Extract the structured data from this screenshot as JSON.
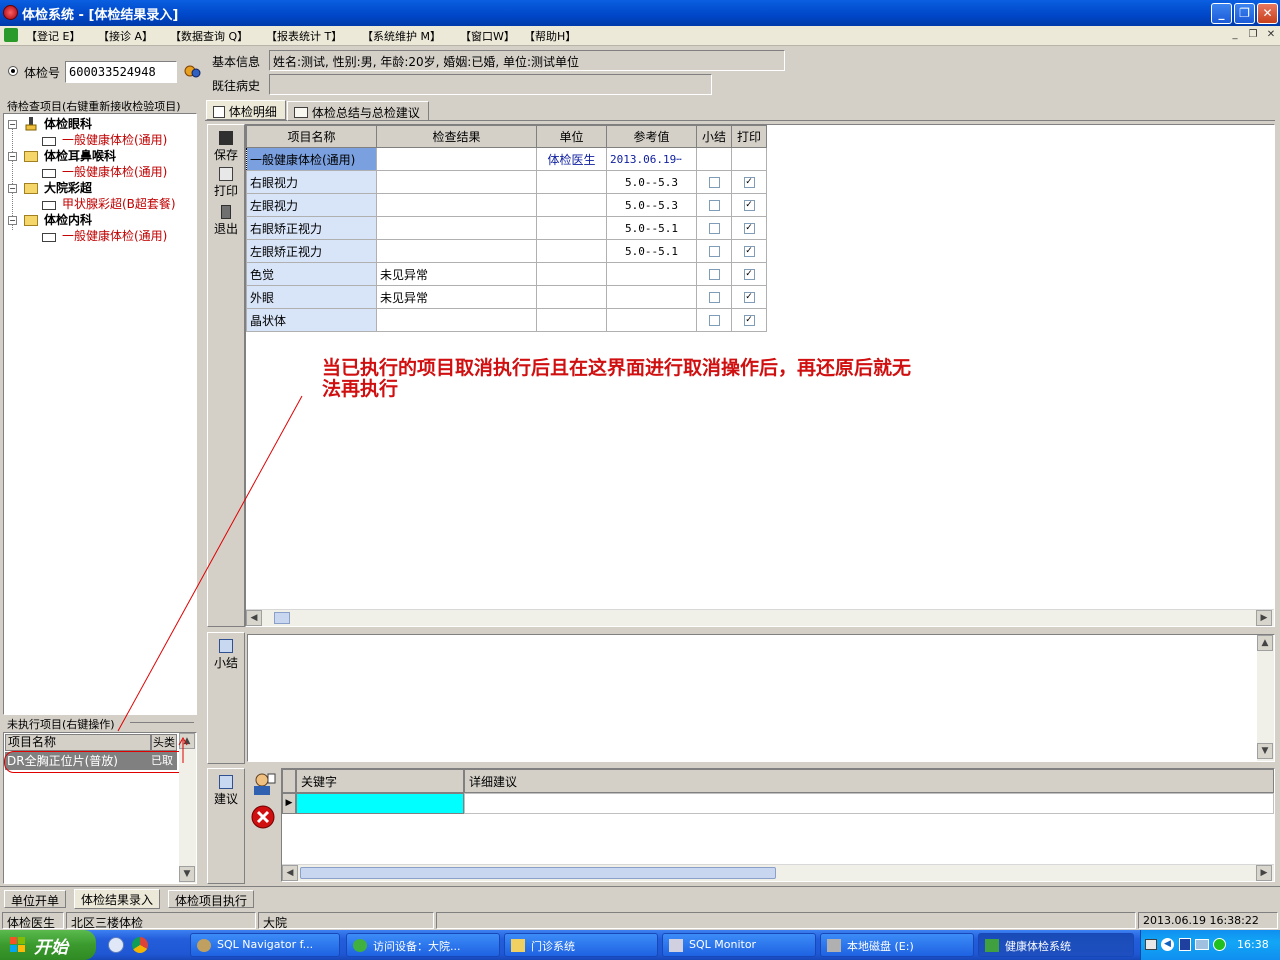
{
  "window": {
    "title": "体检系统 - [体检结果录入]"
  },
  "menu": [
    "【登记 E】",
    "【接诊 A】",
    "【数据查询 Q】",
    "【报表统计 T】",
    "【系统维护 M】",
    "【窗口W】",
    "【帮助H】"
  ],
  "header": {
    "exam_no_label": "体检号",
    "exam_no_value": "600033524948",
    "basic_info_label": "基本信息",
    "basic_info_value": "姓名:测试, 性别:男, 年龄:20岁, 婚姻:已婚, 单位:测试单位",
    "history_label": "既往病史",
    "history_value": ""
  },
  "left_panel": {
    "tree_title": "待检查项目(右键重新接收检验项目)",
    "tree": [
      {
        "dept": "体检眼科",
        "item": "一般健康体检(通用)"
      },
      {
        "dept": "体检耳鼻喉科",
        "item": "一般健康体检(通用)"
      },
      {
        "dept": "大院彩超",
        "item": "甲状腺彩超(B超套餐)"
      },
      {
        "dept": "体检内科",
        "item": "一般健康体检(通用)"
      }
    ],
    "pending_title": "未执行项目(右键操作)",
    "pending_headers": [
      "项目名称",
      "头类"
    ],
    "pending_rows": [
      {
        "name": "DR全胸正位片(普放)",
        "status": "已取"
      }
    ]
  },
  "tabs": [
    "体检明细",
    "体检总结与总检建议"
  ],
  "side_buttons": {
    "save": "保存",
    "print": "打印",
    "exit": "退出"
  },
  "grid": {
    "headers": [
      "项目名称",
      "检查结果",
      "单位",
      "参考值",
      "小结",
      "打印"
    ],
    "rows": [
      {
        "name": "一般健康体检(通用)",
        "result": "",
        "unit": "体检医生",
        "ref": "2013.06.19",
        "summary": null,
        "print": null
      },
      {
        "name": "右眼视力",
        "result": "",
        "unit": "",
        "ref": "5.0--5.3",
        "summary": false,
        "print": true
      },
      {
        "name": "左眼视力",
        "result": "",
        "unit": "",
        "ref": "5.0--5.3",
        "summary": false,
        "print": true
      },
      {
        "name": "右眼矫正视力",
        "result": "",
        "unit": "",
        "ref": "5.0--5.1",
        "summary": false,
        "print": true
      },
      {
        "name": "左眼矫正视力",
        "result": "",
        "unit": "",
        "ref": "5.0--5.1",
        "summary": false,
        "print": true
      },
      {
        "name": "色觉",
        "result": "未见异常",
        "unit": "",
        "ref": "",
        "summary": false,
        "print": true
      },
      {
        "name": "外眼",
        "result": "未见异常",
        "unit": "",
        "ref": "",
        "summary": false,
        "print": true
      },
      {
        "name": "晶状体",
        "result": "",
        "unit": "",
        "ref": "",
        "summary": false,
        "print": true
      }
    ]
  },
  "annotation": {
    "line1": "当已执行的项目取消执行后且在这界面进行取消操作后，再还原后就无",
    "line2": "法再执行"
  },
  "summary_panel": {
    "label": "小结"
  },
  "advice_panel": {
    "label": "建议",
    "headers": [
      "关键字",
      "详细建议"
    ]
  },
  "bottom_tabs": [
    "单位开单",
    "体检结果录入",
    "体检项目执行"
  ],
  "status_bar": [
    "体检医生",
    "北区三楼体检",
    "大院",
    "2013.06.19 16:38:22"
  ],
  "taskbar": {
    "start": "开始",
    "tasks": [
      "SQL Navigator f...",
      "访问设备：大院...",
      "门诊系统",
      "SQL Monitor",
      "本地磁盘 (E:)",
      "健康体检系统"
    ],
    "clock": "16:38"
  },
  "colors": {
    "annotation": "#d01010",
    "advice_cell": "#00ffff",
    "selected_cell": "#7aa0e0"
  }
}
